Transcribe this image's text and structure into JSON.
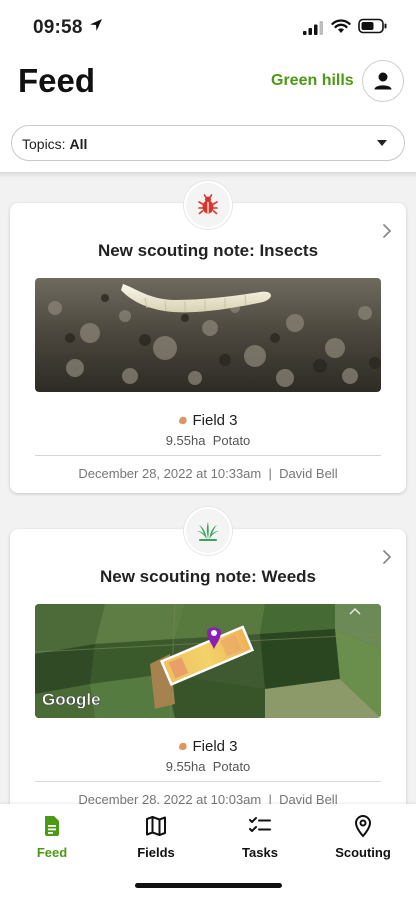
{
  "status_bar": {
    "time": "09:58"
  },
  "header": {
    "title": "Feed",
    "farm_name": "Green hills",
    "topics_label": "Topics:",
    "topics_value": "All"
  },
  "feed": [
    {
      "icon": "bug-icon",
      "title": "New scouting note: Insects",
      "field": "Field 3",
      "area": "9.55ha",
      "crop": "Potato",
      "date": "December 28, 2022 at 10:33am",
      "author": "David Bell"
    },
    {
      "icon": "weed-icon",
      "title": "New scouting note: Weeds",
      "field": "Field 3",
      "area": "9.55ha",
      "crop": "Potato",
      "date": "December 28, 2022 at 10:03am",
      "author": "David Bell",
      "map_attribution": "Google"
    }
  ],
  "nav": [
    {
      "label": "Feed",
      "icon": "feed-icon",
      "active": true
    },
    {
      "label": "Fields",
      "icon": "map-icon",
      "active": false
    },
    {
      "label": "Tasks",
      "icon": "checklist-icon",
      "active": false
    },
    {
      "label": "Scouting",
      "icon": "location-pin-icon",
      "active": false
    }
  ],
  "colors": {
    "accent": "#4c9a14",
    "insect_red": "#d9342b",
    "weed_green": "#3aa55a"
  }
}
